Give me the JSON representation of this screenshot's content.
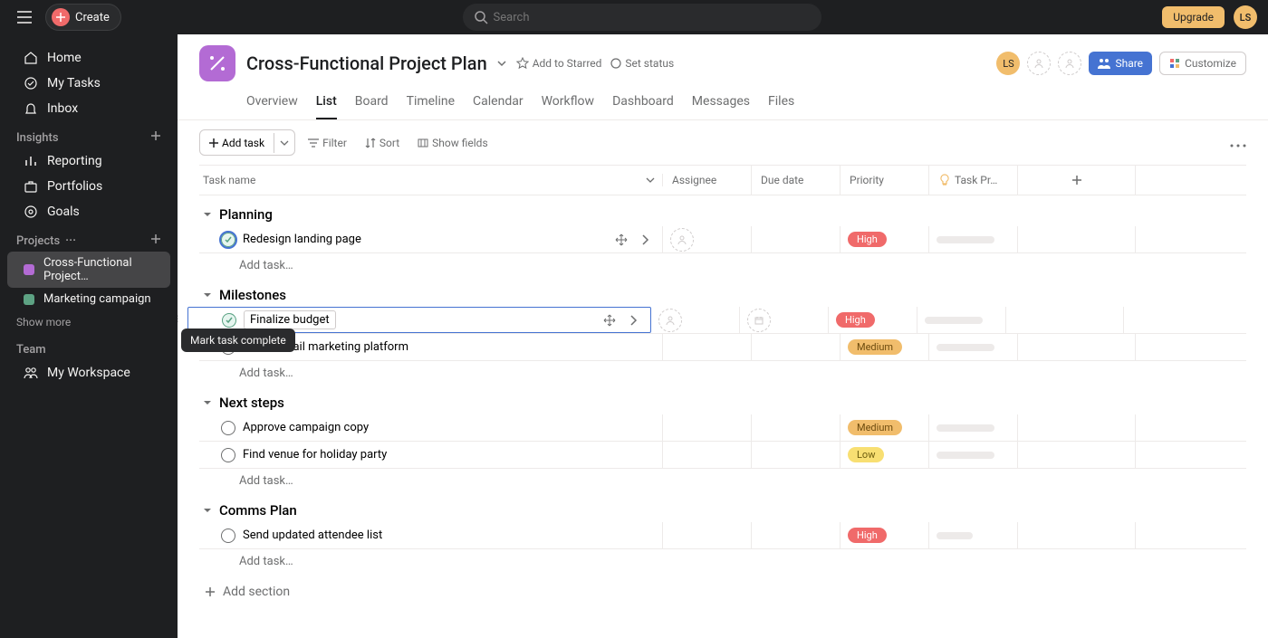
{
  "topbar": {
    "create": "Create",
    "search_placeholder": "Search",
    "upgrade": "Upgrade",
    "user_initials": "LS"
  },
  "sidebar": {
    "home": "Home",
    "my_tasks": "My Tasks",
    "inbox": "Inbox",
    "insights_label": "Insights",
    "reporting": "Reporting",
    "portfolios": "Portfolios",
    "goals": "Goals",
    "projects_label": "Projects",
    "projects": [
      {
        "name": "Cross-Functional Project…",
        "color": "#b36bd4",
        "active": true
      },
      {
        "name": "Marketing campaign",
        "color": "#5da283",
        "active": false
      }
    ],
    "show_more": "Show more",
    "team_label": "Team",
    "my_workspace": "My Workspace"
  },
  "project": {
    "title": "Cross-Functional Project Plan",
    "add_to_starred": "Add to Starred",
    "set_status": "Set status",
    "share": "Share",
    "customize": "Customize",
    "user_initials": "LS",
    "tabs": [
      "Overview",
      "List",
      "Board",
      "Timeline",
      "Calendar",
      "Workflow",
      "Dashboard",
      "Messages",
      "Files"
    ],
    "active_tab": 1
  },
  "toolbar": {
    "add_task": "Add task",
    "filter": "Filter",
    "sort": "Sort",
    "show_fields": "Show fields"
  },
  "columns": {
    "task_name": "Task name",
    "assignee": "Assignee",
    "due_date": "Due date",
    "priority": "Priority",
    "task_progress": "Task Pr…"
  },
  "sections": [
    {
      "name": "Planning",
      "tasks": [
        {
          "name": "Redesign landing page",
          "priority": "High",
          "pri_class": "pri-high",
          "completed": true
        }
      ]
    },
    {
      "name": "Milestones",
      "tasks": [
        {
          "name": "Finalize budget",
          "priority": "High",
          "pri_class": "pri-high",
          "selected": true,
          "hovered": true
        },
        {
          "name": "… new email marketing platform",
          "priority": "Medium",
          "pri_class": "pri-med",
          "partial_prefix": "e"
        }
      ]
    },
    {
      "name": "Next steps",
      "tasks": [
        {
          "name": "Approve campaign copy",
          "priority": "Medium",
          "pri_class": "pri-med"
        },
        {
          "name": "Find venue for holiday party",
          "priority": "Low",
          "pri_class": "pri-low"
        }
      ]
    },
    {
      "name": "Comms Plan",
      "tasks": [
        {
          "name": "Send updated attendee list",
          "priority": "High",
          "pri_class": "pri-high",
          "progress_short": true
        }
      ]
    }
  ],
  "strings": {
    "add_task_row": "Add task…",
    "add_section": "Add section",
    "tooltip_mark_complete": "Mark task complete"
  }
}
